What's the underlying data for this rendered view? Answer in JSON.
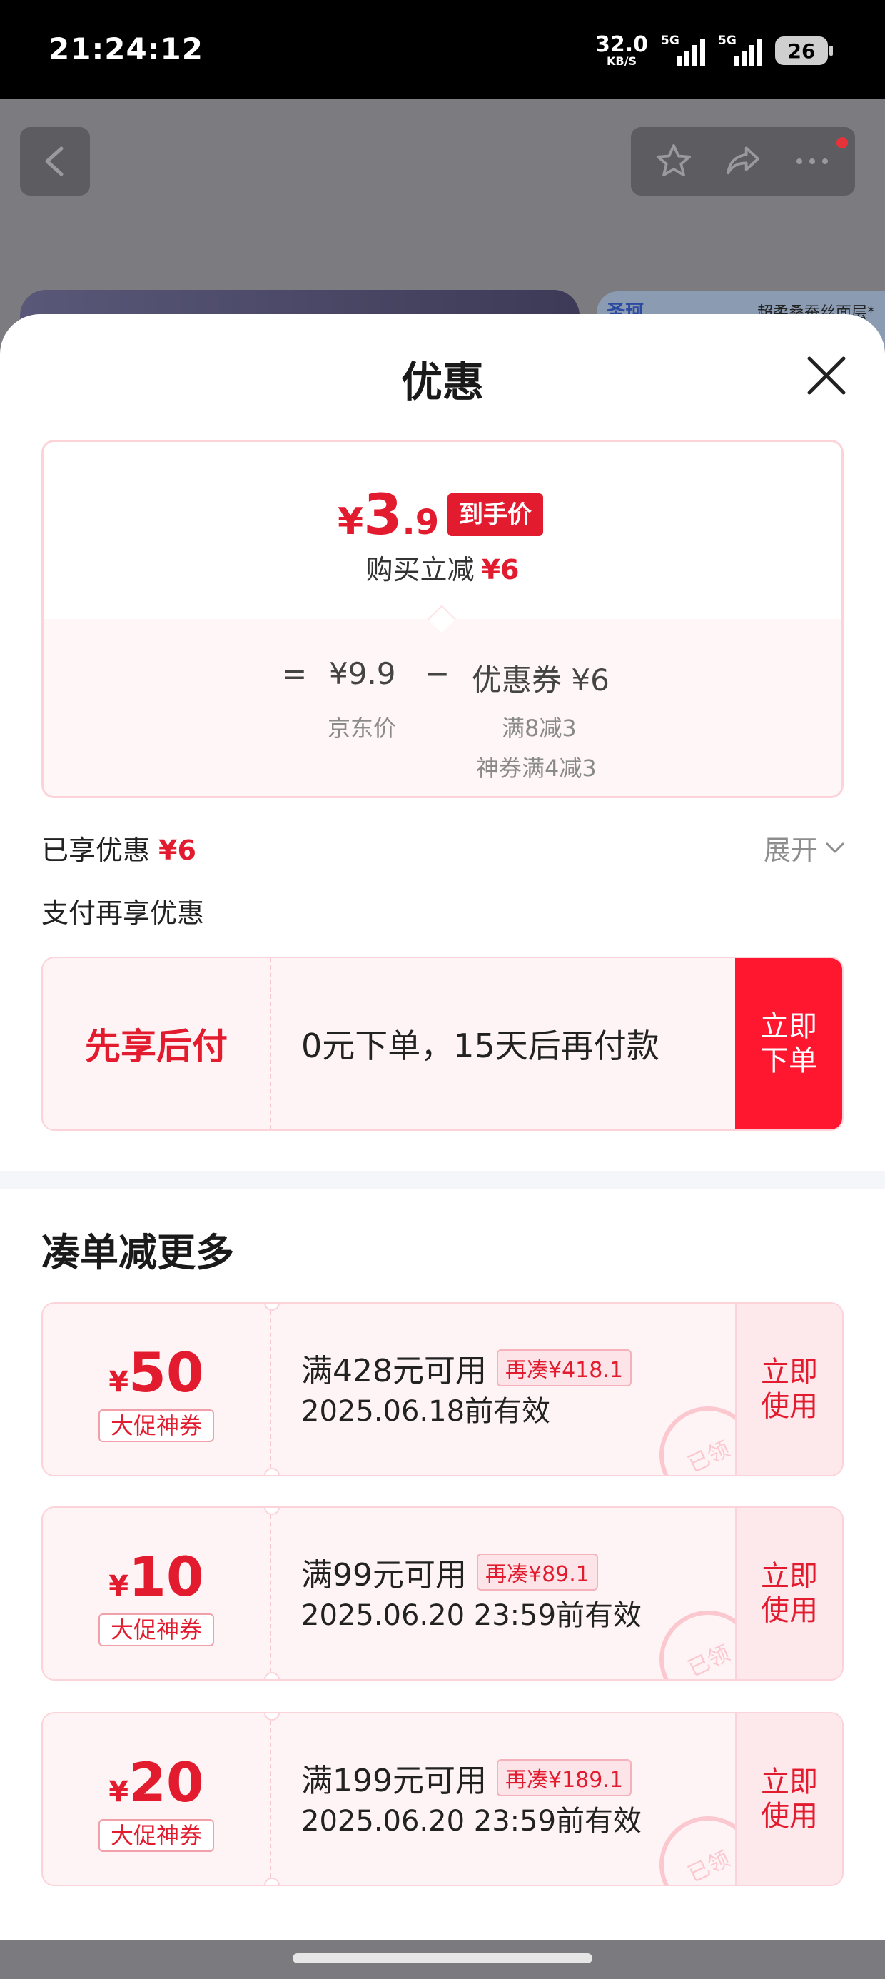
{
  "status_bar": {
    "time": "21:24:12",
    "net_speed_value": "32.0",
    "net_speed_unit": "KB/S",
    "sim1": "5G",
    "sim2": "5G",
    "battery": "26"
  },
  "background": {
    "thumb_text": "超柔桑蚕丝面层*",
    "thumb_brand": "圣珂"
  },
  "sheet": {
    "title": "优惠",
    "price": {
      "currency": "¥",
      "int": "3",
      "dec": ".9",
      "badge": "到手价",
      "save_label": "购买立减",
      "save_amount": "¥6"
    },
    "formula": {
      "equals": "=",
      "jd_price": "¥9.9",
      "minus": "−",
      "coupon_label": "优惠券 ¥6",
      "jd_price_label": "京东价",
      "coupon_detail_1": "满8减3",
      "coupon_detail_2": "神券满4减3"
    },
    "enjoyed_label": "已享优惠",
    "enjoyed_amount": "¥6",
    "expand_label": "展开",
    "pay_title": "支付再享优惠",
    "bnpl": {
      "title": "先享后付",
      "desc": "0元下单，15天后再付款",
      "button_line1": "立即",
      "button_line2": "下单"
    },
    "section_title": "凑单减更多",
    "coupons": [
      {
        "currency": "¥",
        "amount": "50",
        "tag": "大促神券",
        "condition": "满428元可用",
        "need": "再凑¥418.1",
        "valid": "2025.06.18前有效",
        "action_line1": "立即",
        "action_line2": "使用",
        "stamp": "已领"
      },
      {
        "currency": "¥",
        "amount": "10",
        "tag": "大促神券",
        "condition": "满99元可用",
        "need": "再凑¥89.1",
        "valid": "2025.06.20 23:59前有效",
        "action_line1": "立即",
        "action_line2": "使用",
        "stamp": "已领"
      },
      {
        "currency": "¥",
        "amount": "20",
        "tag": "大促神券",
        "condition": "满199元可用",
        "need": "再凑¥189.1",
        "valid": "2025.06.20 23:59前有效",
        "action_line1": "立即",
        "action_line2": "使用",
        "stamp": "已领"
      }
    ]
  },
  "colors": {
    "accent_red": "#e31b2e",
    "button_red": "#ff1730",
    "coupon_bg": "#fff4f5"
  }
}
